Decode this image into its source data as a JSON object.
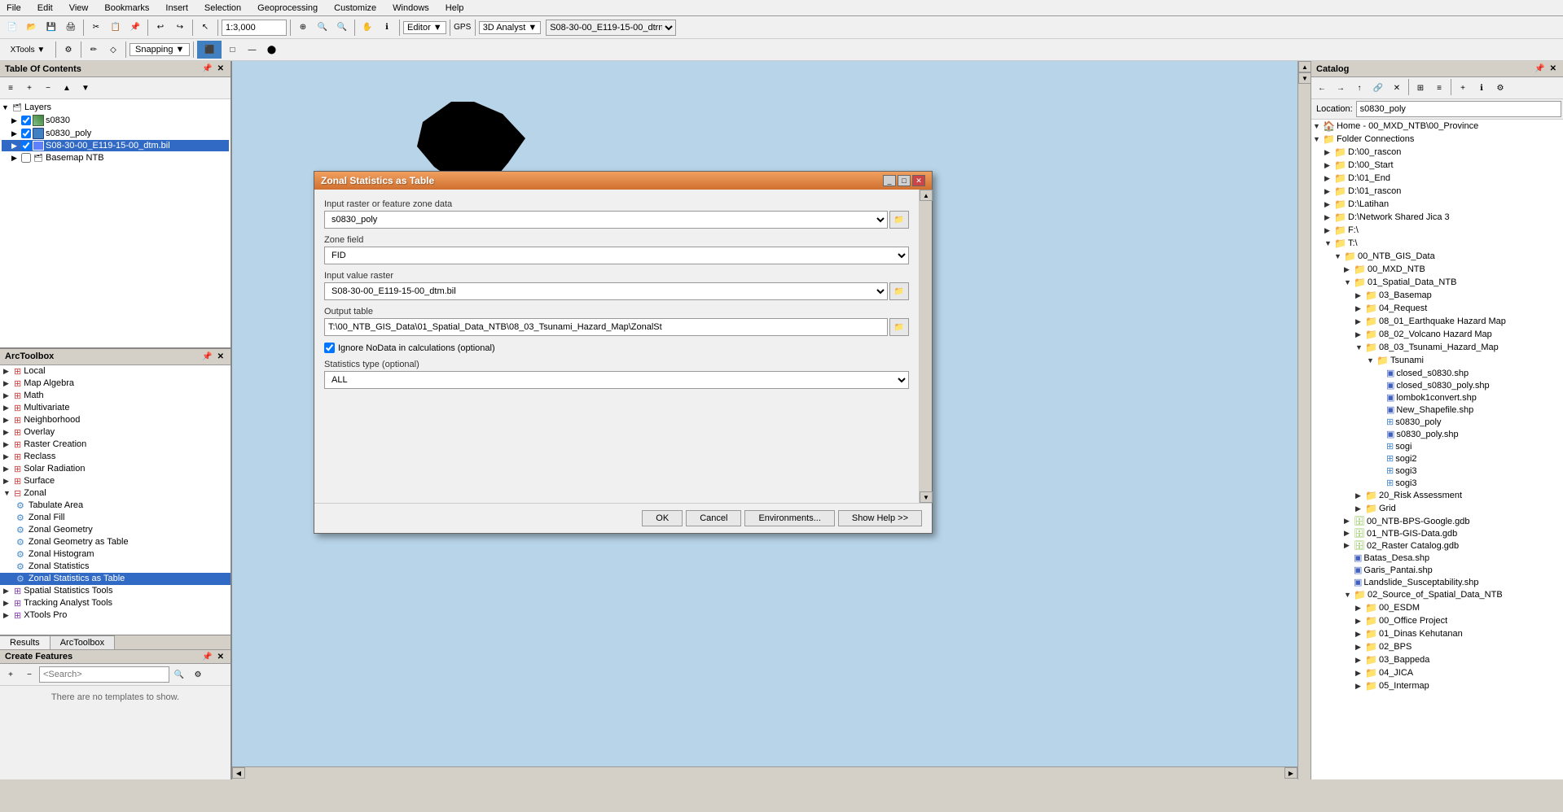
{
  "menubar": {
    "items": [
      "File",
      "Edit",
      "View",
      "Bookmarks",
      "Insert",
      "Selection",
      "Geoprocessing",
      "Customize",
      "Windows",
      "Help"
    ]
  },
  "toolbar": {
    "scale": "1:3,000",
    "editor_label": "Editor ▼",
    "analyst_label": "3D Analyst ▼",
    "snapping_label": "Snapping ▼",
    "layer_dropdown": "S08-30-00_E119-15-00_dtrn ▼"
  },
  "toc": {
    "title": "Table Of Contents",
    "layers": [
      {
        "id": "layers-group",
        "label": "Layers",
        "level": 0,
        "expanded": true,
        "type": "group"
      },
      {
        "id": "s0830",
        "label": "s0830",
        "level": 1,
        "checked": true,
        "type": "raster"
      },
      {
        "id": "s0830_poly",
        "label": "s0830_poly",
        "level": 1,
        "checked": true,
        "type": "vector"
      },
      {
        "id": "s08-dtm",
        "label": "S08-30-00_E119-15-00_dtm.bil",
        "level": 1,
        "checked": true,
        "type": "raster",
        "selected": true
      },
      {
        "id": "basemap",
        "label": "Basemap NTB",
        "level": 1,
        "checked": false,
        "type": "group"
      }
    ]
  },
  "arctoolbox": {
    "title": "ArcToolbox",
    "items": [
      {
        "id": "local",
        "label": "Local",
        "level": 0,
        "type": "toolbox",
        "expanded": false
      },
      {
        "id": "mapalgebra",
        "label": "Map Algebra",
        "level": 0,
        "type": "toolbox",
        "expanded": false
      },
      {
        "id": "math",
        "label": "Math",
        "level": 0,
        "type": "toolbox",
        "expanded": false
      },
      {
        "id": "multivariate",
        "label": "Multivariate",
        "level": 0,
        "type": "toolbox",
        "expanded": false
      },
      {
        "id": "neighborhood",
        "label": "Neighborhood",
        "level": 0,
        "type": "toolbox",
        "expanded": false
      },
      {
        "id": "overlay",
        "label": "Overlay",
        "level": 0,
        "type": "toolbox",
        "expanded": false
      },
      {
        "id": "rastercreation",
        "label": "Raster Creation",
        "level": 0,
        "type": "toolbox",
        "expanded": false
      },
      {
        "id": "reclass",
        "label": "Reclass",
        "level": 0,
        "type": "toolbox",
        "expanded": false
      },
      {
        "id": "solarradiation",
        "label": "Solar Radiation",
        "level": 0,
        "type": "toolbox",
        "expanded": false
      },
      {
        "id": "surface",
        "label": "Surface",
        "level": 0,
        "type": "toolbox",
        "expanded": false
      },
      {
        "id": "zonal",
        "label": "Zonal",
        "level": 0,
        "type": "toolbox",
        "expanded": true
      },
      {
        "id": "tabulatearea",
        "label": "Tabulate Area",
        "level": 1,
        "type": "tool"
      },
      {
        "id": "zonalfill",
        "label": "Zonal Fill",
        "level": 1,
        "type": "tool"
      },
      {
        "id": "zonalgeometry",
        "label": "Zonal Geometry",
        "level": 1,
        "type": "tool"
      },
      {
        "id": "zonalgeometrytable",
        "label": "Zonal Geometry as Table",
        "level": 1,
        "type": "tool"
      },
      {
        "id": "zonalhistogram",
        "label": "Zonal Histogram",
        "level": 1,
        "type": "tool"
      },
      {
        "id": "zonalstatistics",
        "label": "Zonal Statistics",
        "level": 1,
        "type": "tool"
      },
      {
        "id": "zonalstatisticstable",
        "label": "Zonal Statistics as Table",
        "level": 1,
        "type": "tool",
        "selected": true
      },
      {
        "id": "spatialstatistics",
        "label": "Spatial Statistics Tools",
        "level": 0,
        "type": "toolbox2",
        "expanded": false
      },
      {
        "id": "trackinganalyst",
        "label": "Tracking Analyst Tools",
        "level": 0,
        "type": "toolbox2",
        "expanded": false
      },
      {
        "id": "xtoolspro",
        "label": "XTools Pro",
        "level": 0,
        "type": "toolbox2",
        "expanded": false
      }
    ]
  },
  "bottom_tabs": {
    "tabs": [
      "Results",
      "ArcToolbox"
    ]
  },
  "create_features": {
    "title": "Create Features",
    "search_placeholder": "<Search>",
    "empty_message": "There are no templates to show."
  },
  "dialog": {
    "title": "Zonal Statistics as Table",
    "input_raster_label": "Input raster or feature zone data",
    "input_raster_value": "s0830_poly",
    "zone_field_label": "Zone field",
    "zone_field_value": "FID",
    "input_value_raster_label": "Input value raster",
    "input_value_raster_value": "S08-30-00_E119-15-00_dtm.bil",
    "output_table_label": "Output table",
    "output_table_value": "T:\\00_NTB_GIS_Data\\01_Spatial_Data_NTB\\08_03_Tsunami_Hazard_Map\\ZonalSt",
    "ignore_nodata_label": "Ignore NoData in calculations (optional)",
    "ignore_nodata_checked": true,
    "statistics_type_label": "Statistics type (optional)",
    "statistics_type_value": "ALL",
    "buttons": {
      "ok": "OK",
      "cancel": "Cancel",
      "environments": "Environments...",
      "show_help": "Show Help >>"
    }
  },
  "catalog": {
    "title": "Catalog",
    "location_label": "Location:",
    "location_value": "s0830_poly",
    "tree": [
      {
        "id": "home",
        "label": "Home - 00_MXD_NTB\\00_Province",
        "level": 0,
        "expanded": true,
        "type": "folder"
      },
      {
        "id": "folderconn",
        "label": "Folder Connections",
        "level": 0,
        "expanded": true,
        "type": "folder"
      },
      {
        "id": "d00rascon",
        "label": "D:\\00_rascon",
        "level": 1,
        "expanded": false,
        "type": "folder"
      },
      {
        "id": "d00start",
        "label": "D:\\00_Start",
        "level": 1,
        "expanded": false,
        "type": "folder"
      },
      {
        "id": "d01end",
        "label": "D:\\01_End",
        "level": 1,
        "expanded": false,
        "type": "folder"
      },
      {
        "id": "d01rascon",
        "label": "D:\\01_rascon",
        "level": 1,
        "expanded": false,
        "type": "folder"
      },
      {
        "id": "dlatihan",
        "label": "D:\\Latihan",
        "level": 1,
        "expanded": false,
        "type": "folder"
      },
      {
        "id": "dnetwork",
        "label": "D:\\Network Shared Jica 3",
        "level": 1,
        "expanded": false,
        "type": "folder"
      },
      {
        "id": "f",
        "label": "F:\\",
        "level": 1,
        "expanded": false,
        "type": "folder"
      },
      {
        "id": "t",
        "label": "T:\\",
        "level": 1,
        "expanded": true,
        "type": "folder"
      },
      {
        "id": "ntbgis",
        "label": "00_NTB_GIS_Data",
        "level": 2,
        "expanded": true,
        "type": "folder"
      },
      {
        "id": "mxdntb",
        "label": "00_MXD_NTB",
        "level": 3,
        "expanded": false,
        "type": "folder"
      },
      {
        "id": "spatialntb",
        "label": "01_Spatial_Data_NTB",
        "level": 3,
        "expanded": true,
        "type": "folder"
      },
      {
        "id": "basemap",
        "label": "03_Basemap",
        "level": 4,
        "expanded": false,
        "type": "folder"
      },
      {
        "id": "request",
        "label": "04_Request",
        "level": 4,
        "expanded": false,
        "type": "folder"
      },
      {
        "id": "earthquake",
        "label": "08_01_Earthquake Hazard Map",
        "level": 4,
        "expanded": false,
        "type": "folder"
      },
      {
        "id": "volcano",
        "label": "08_02_Volcano Hazard Map",
        "level": 4,
        "expanded": false,
        "type": "folder"
      },
      {
        "id": "tsunami",
        "label": "08_03_Tsunami_Hazard_Map",
        "level": 4,
        "expanded": true,
        "type": "folder"
      },
      {
        "id": "tsunamifolder",
        "label": "Tsunami",
        "level": 5,
        "expanded": true,
        "type": "folder"
      },
      {
        "id": "closed_s0830",
        "label": "closed_s0830.shp",
        "level": 6,
        "type": "shapefile"
      },
      {
        "id": "closed_s0830_poly",
        "label": "closed_s0830_poly.shp",
        "level": 6,
        "type": "shapefile"
      },
      {
        "id": "lombok1convert",
        "label": "lombok1convert.shp",
        "level": 6,
        "type": "shapefile"
      },
      {
        "id": "newshape",
        "label": "New_Shapefile.shp",
        "level": 6,
        "type": "shapefile"
      },
      {
        "id": "s0830poly",
        "label": "s0830_poly",
        "level": 6,
        "type": "table"
      },
      {
        "id": "s0830polyshp",
        "label": "s0830_poly.shp",
        "level": 6,
        "type": "shapefile"
      },
      {
        "id": "sogi",
        "label": "sogi",
        "level": 6,
        "type": "table"
      },
      {
        "id": "sogi2",
        "label": "sogi2",
        "level": 6,
        "type": "table"
      },
      {
        "id": "sogi3",
        "label": "sogi3",
        "level": 6,
        "type": "table"
      },
      {
        "id": "sogi3b",
        "label": "sogi3",
        "level": 6,
        "type": "table"
      },
      {
        "id": "riskassess",
        "label": "20_Risk Assessment",
        "level": 4,
        "expanded": false,
        "type": "folder"
      },
      {
        "id": "grid",
        "label": "Grid",
        "level": 4,
        "expanded": false,
        "type": "folder"
      },
      {
        "id": "ntbbpsgoogle",
        "label": "00_NTB-BPS-Google.gdb",
        "level": 3,
        "expanded": false,
        "type": "gdb"
      },
      {
        "id": "ntbgisdata",
        "label": "01_NTB-GIS-Data.gdb",
        "level": 3,
        "expanded": false,
        "type": "gdb"
      },
      {
        "id": "rastercatalog",
        "label": "02_Raster Catalog.gdb",
        "level": 3,
        "expanded": false,
        "type": "gdb"
      },
      {
        "id": "batasdesashp",
        "label": "Batas_Desa.shp",
        "level": 3,
        "type": "shapefile"
      },
      {
        "id": "garispantai",
        "label": "Garis_Pantai.shp",
        "level": 3,
        "type": "shapefile"
      },
      {
        "id": "landslide",
        "label": "Landslide_Susceptability.shp",
        "level": 3,
        "type": "shapefile"
      },
      {
        "id": "source_spatial",
        "label": "02_Source_of_Spatial_Data_NTB",
        "level": 3,
        "expanded": true,
        "type": "folder"
      },
      {
        "id": "esdm",
        "label": "00_ESDM",
        "level": 4,
        "expanded": false,
        "type": "folder"
      },
      {
        "id": "officeproject",
        "label": "00_Office Project",
        "level": 4,
        "expanded": false,
        "type": "folder"
      },
      {
        "id": "dinaskehutanan",
        "label": "01_Dinas Kehutanan",
        "level": 4,
        "expanded": false,
        "type": "folder"
      },
      {
        "id": "bps",
        "label": "02_BPS",
        "level": 4,
        "expanded": false,
        "type": "folder"
      },
      {
        "id": "bappeda",
        "label": "03_Bappeda",
        "level": 4,
        "expanded": false,
        "type": "folder"
      },
      {
        "id": "jica",
        "label": "04_JICA",
        "level": 4,
        "expanded": false,
        "type": "folder"
      },
      {
        "id": "intermap",
        "label": "05_Intermap",
        "level": 4,
        "expanded": false,
        "type": "folder"
      }
    ]
  }
}
